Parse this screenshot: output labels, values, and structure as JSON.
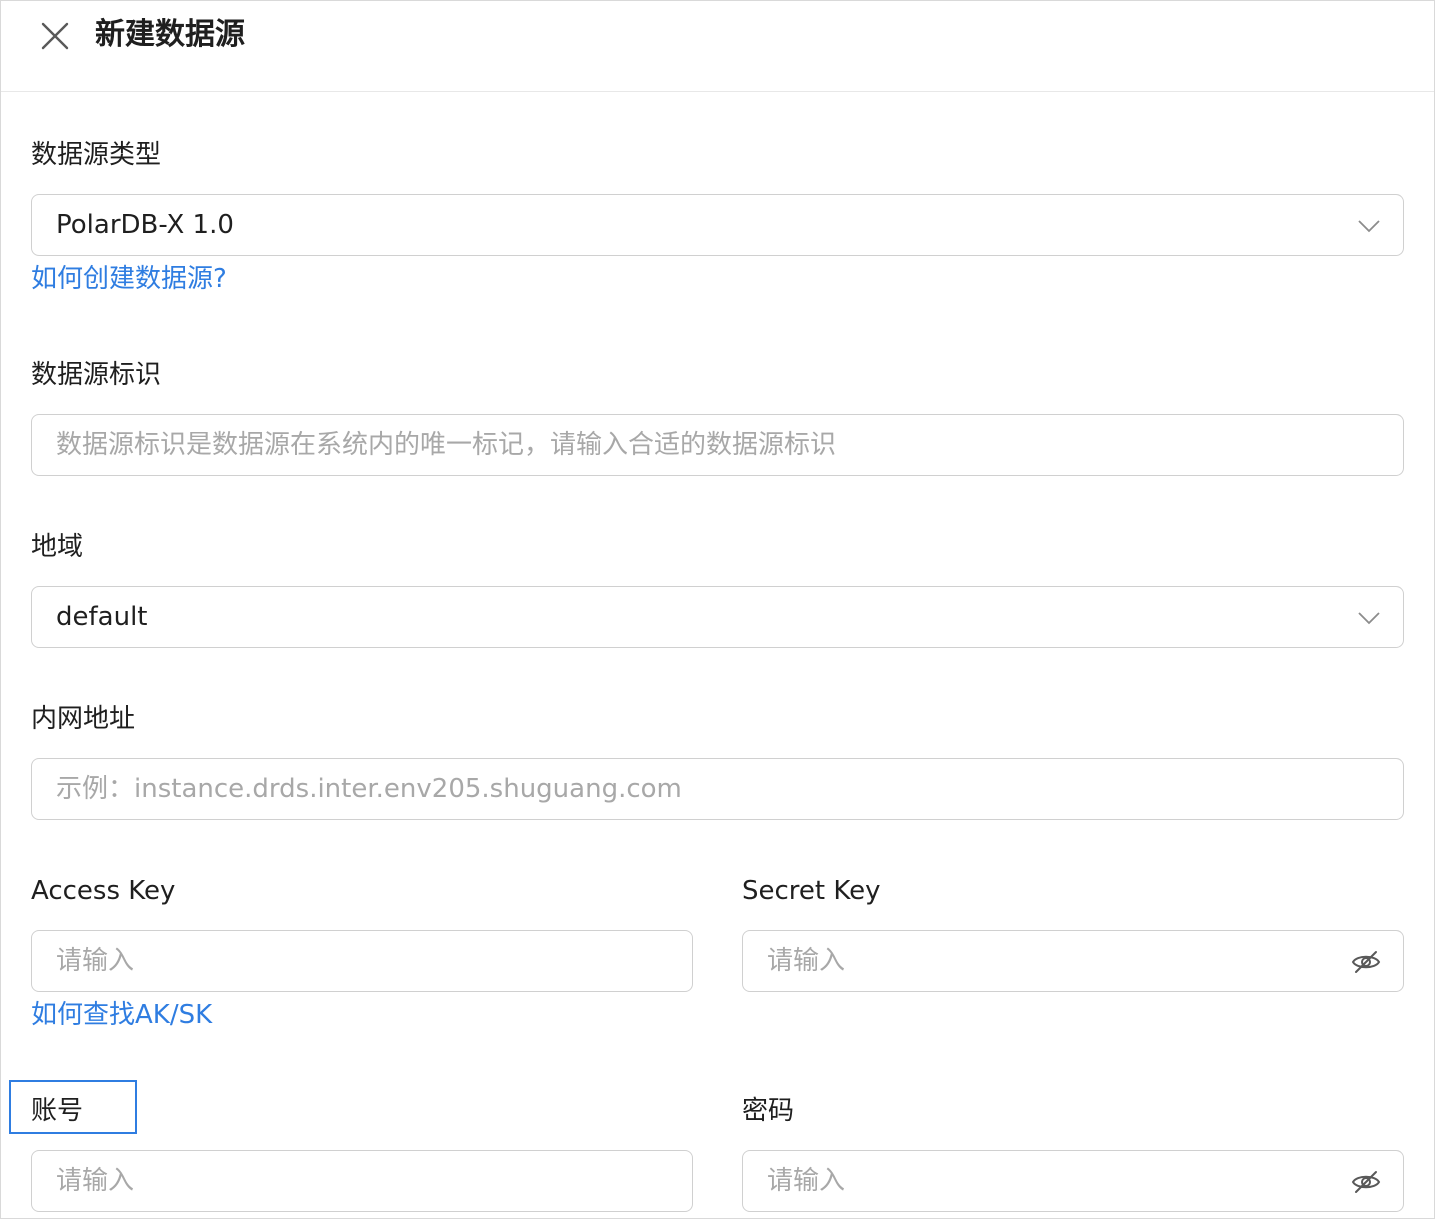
{
  "header": {
    "title": "新建数据源"
  },
  "form": {
    "type": {
      "label": "数据源类型",
      "value": "PolarDB-X 1.0",
      "help_link": "如何创建数据源?"
    },
    "identifier": {
      "label": "数据源标识",
      "placeholder": "数据源标识是数据源在系统内的唯一标记，请输入合适的数据源标识"
    },
    "region": {
      "label": "地域",
      "value": "default"
    },
    "intranet": {
      "label": "内网地址",
      "placeholder": "示例：instance.drds.inter.env205.shuguang.com"
    },
    "access_key": {
      "label": "Access Key",
      "placeholder": "请输入",
      "help_link": "如何查找AK/SK"
    },
    "secret_key": {
      "label": "Secret Key",
      "placeholder": "请输入"
    },
    "account": {
      "label": "账号",
      "placeholder": "请输入"
    },
    "password": {
      "label": "密码",
      "placeholder": "请输入"
    }
  },
  "colors": {
    "link": "#2f7de1",
    "border": "#d0d0d0",
    "placeholder": "#a8a8a8",
    "icon": "#8c8c8c"
  },
  "icons": {
    "close": "close-icon",
    "dropdown": "chevron-down-icon",
    "password_toggle": "eye-off-icon"
  }
}
